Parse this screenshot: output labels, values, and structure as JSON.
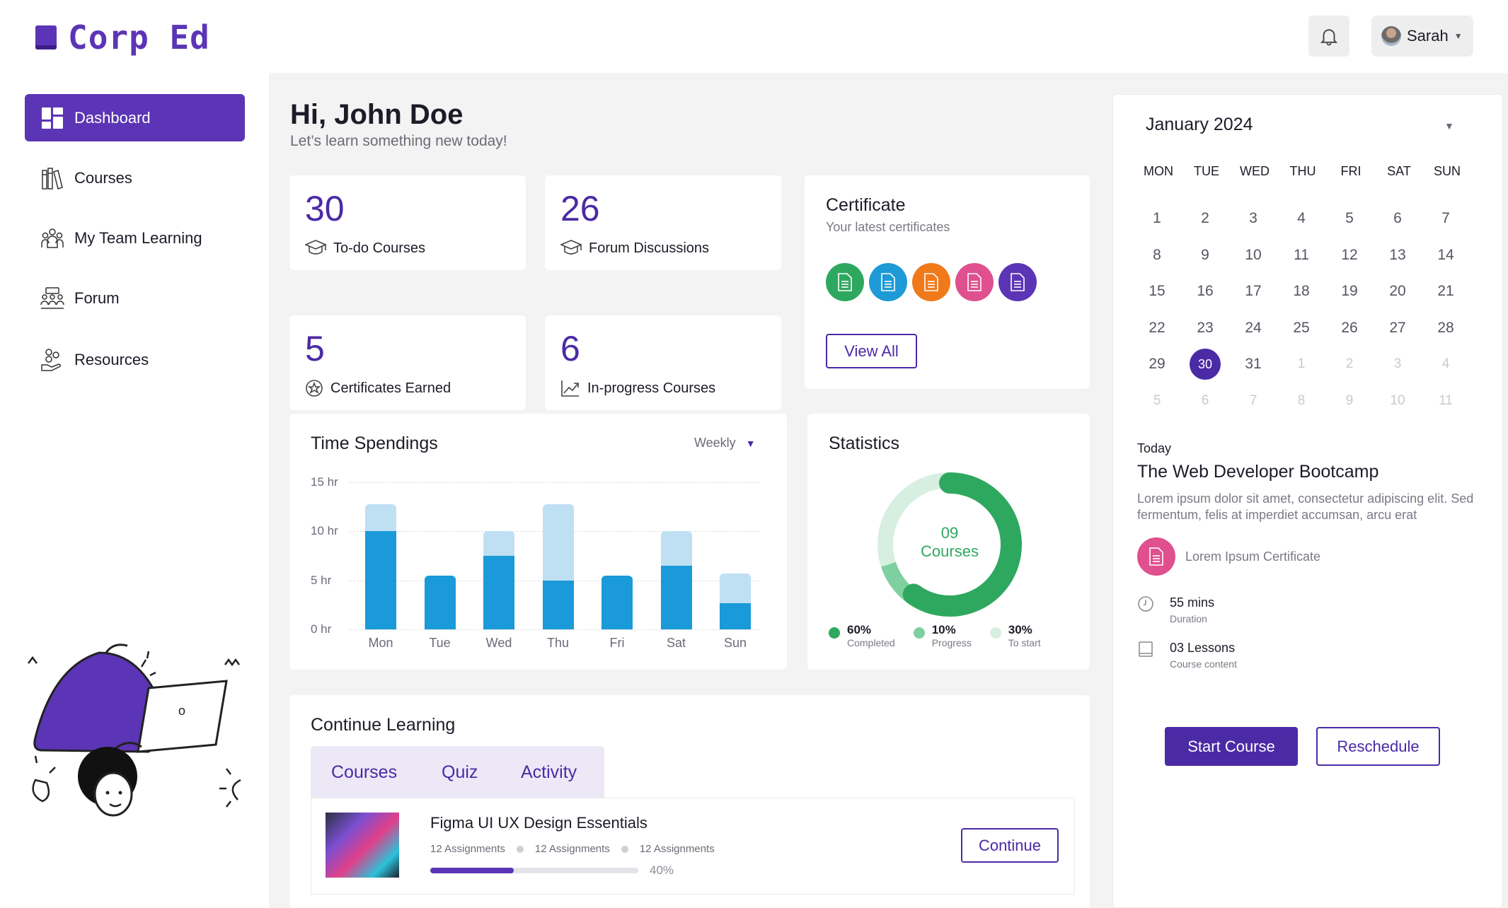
{
  "brand": {
    "name": "Corp Ed",
    "color": "#5b35b5"
  },
  "header": {
    "user_name": "Sarah",
    "notification_icon": "bell-icon"
  },
  "sidebar": {
    "items": [
      {
        "label": "Dashboard",
        "icon": "dashboard-icon",
        "active": true
      },
      {
        "label": "Courses",
        "icon": "books-icon"
      },
      {
        "label": "My Team Learning",
        "icon": "team-icon"
      },
      {
        "label": "Forum",
        "icon": "forum-icon"
      },
      {
        "label": "Resources",
        "icon": "resources-icon"
      }
    ]
  },
  "greeting": {
    "title": "Hi, John Doe",
    "subtitle": "Let’s learn something new today!"
  },
  "stats": [
    {
      "value": "30",
      "label": "To-do Courses",
      "icon": "graduation-cap-icon"
    },
    {
      "value": "26",
      "label": "Forum Discussions",
      "icon": "graduation-cap-icon"
    },
    {
      "value": "5",
      "label": "Certificates Earned",
      "icon": "badge-icon"
    },
    {
      "value": "6",
      "label": "In-progress Courses",
      "icon": "trend-up-icon"
    }
  ],
  "certificate": {
    "title": "Certificate",
    "subtitle": "Your latest certificates",
    "colors": [
      "#2fa85f",
      "#1e9ad6",
      "#f07a1a",
      "#e0508e",
      "#5b35b5"
    ],
    "view_all": "View All"
  },
  "time_spendings": {
    "title": "Time Spendings",
    "period": "Weekly"
  },
  "chart_data": {
    "type": "bar",
    "title": "Time Spendings",
    "categories": [
      "Mon",
      "Tue",
      "Wed",
      "Thu",
      "Fri",
      "Sat",
      "Sun"
    ],
    "series": [
      {
        "values": [
          10,
          5.5,
          7.5,
          5,
          5.5,
          6.5,
          2.7
        ],
        "color": "#1a9ad8"
      },
      {
        "values": [
          2.8,
          0,
          2.5,
          7.8,
          0,
          3.5,
          3
        ],
        "color": "#bfe0f3"
      }
    ],
    "yticks": [
      "0 hr",
      "5 hr",
      "10 hr",
      "15 hr"
    ],
    "ylim": [
      0,
      15
    ],
    "stacked": true,
    "grid": true
  },
  "statistics": {
    "title": "Statistics",
    "center_value": "09",
    "center_label": "Courses",
    "segments": [
      {
        "percent": "60%",
        "label": "Completed",
        "value": 60,
        "color": "#2fa85f"
      },
      {
        "percent": "10%",
        "label": "Progress",
        "value": 10,
        "color": "#7fd0a0"
      },
      {
        "percent": "30%",
        "label": "To start",
        "value": 30,
        "color": "#d7efe0"
      }
    ]
  },
  "continue_learning": {
    "title": "Continue Learning",
    "tabs": [
      "Courses",
      "Quiz",
      "Activity"
    ],
    "course": {
      "name": "Figma UI UX Design Essentials",
      "meta": [
        "12 Assignments",
        "12 Assignments",
        "12 Assignments"
      ],
      "progress_label": "40%",
      "progress": 0.4,
      "button": "Continue"
    }
  },
  "calendar": {
    "month": "January 2024",
    "weekdays": [
      "MON",
      "TUE",
      "WED",
      "THU",
      "FRI",
      "SAT",
      "SUN"
    ],
    "weeks": [
      [
        "1",
        "2",
        "3",
        "4",
        "5",
        "6",
        "7"
      ],
      [
        "8",
        "9",
        "10",
        "11",
        "12",
        "13",
        "14"
      ],
      [
        "15",
        "16",
        "17",
        "18",
        "19",
        "20",
        "21"
      ],
      [
        "22",
        "23",
        "24",
        "25",
        "26",
        "27",
        "28"
      ],
      [
        "29",
        "30",
        "31",
        "1",
        "2",
        "3",
        "4"
      ],
      [
        "5",
        "6",
        "7",
        "8",
        "9",
        "10",
        "11"
      ]
    ],
    "selected": "30"
  },
  "today": {
    "label": "Today",
    "title": "The Web Developer Bootcamp",
    "description": "Lorem ipsum dolor sit amet, consectetur adipiscing elit. Sed fermentum, felis at imperdiet accumsan, arcu erat",
    "certificate": "Lorem Ipsum Certificate",
    "duration_value": "55 mins",
    "duration_label": "Duration",
    "lessons_value": "03 Lessons",
    "lessons_label": "Course content",
    "start": "Start Course",
    "reschedule": "Reschedule"
  }
}
